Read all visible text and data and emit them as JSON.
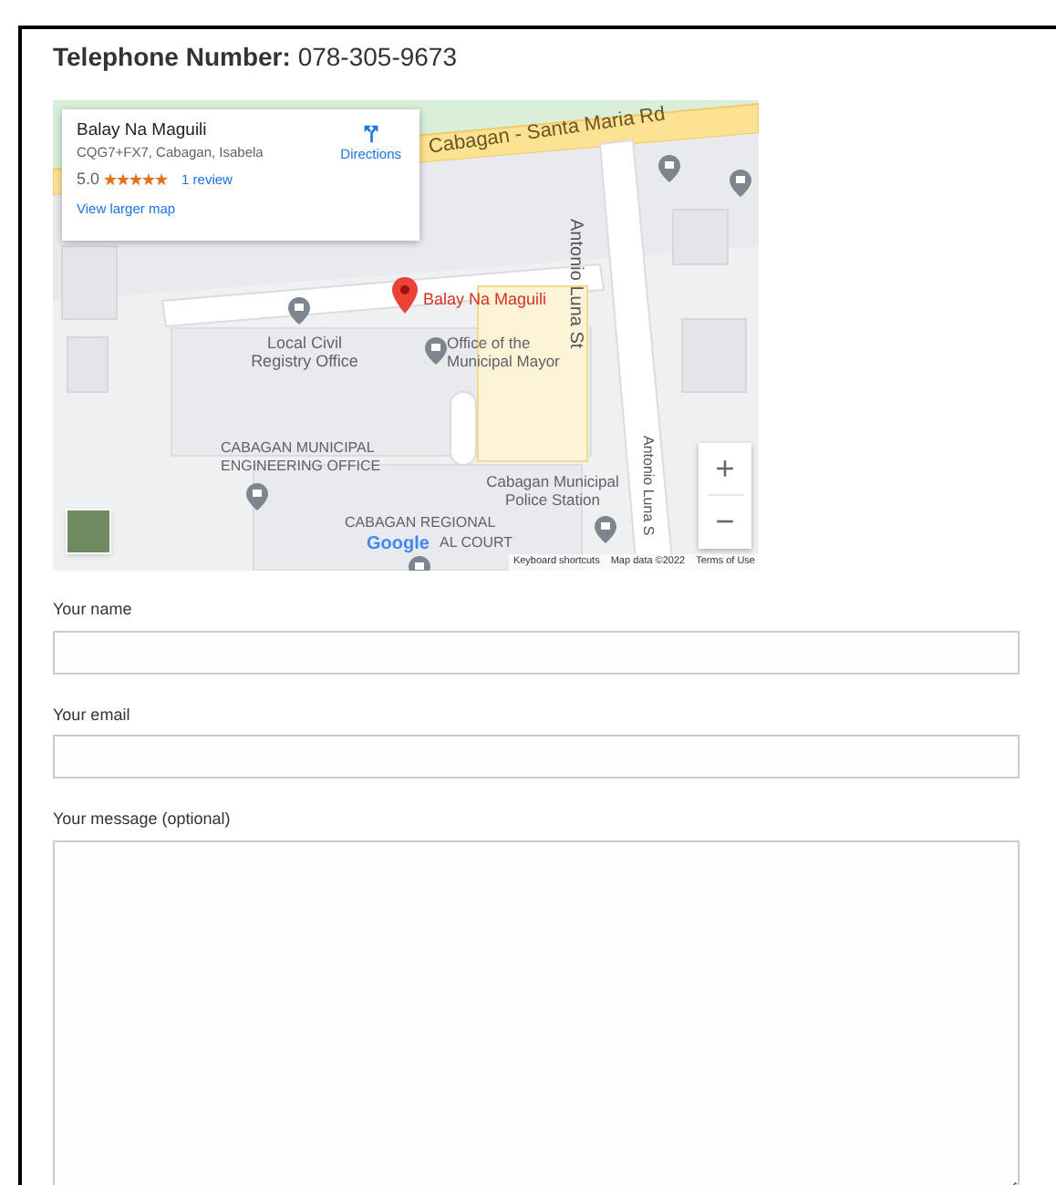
{
  "contact": {
    "label": "Telephone Number:",
    "value": "078-305-9673"
  },
  "map": {
    "info_card": {
      "title": "Balay Na Maguili",
      "address": "CQG7+FX7, Cabagan, Isabela",
      "rating": "5.0",
      "stars": 5,
      "reviews": "1 review",
      "larger_map_link": "View larger map",
      "directions": "Directions"
    },
    "labels": [
      {
        "text": "Cabagan - Santa Maria Rd",
        "kind": "road"
      },
      {
        "text": "Antonio Luna St",
        "kind": "street"
      },
      {
        "text": "Balay Na Maguili",
        "kind": "pin"
      },
      {
        "text": "Local Civil Registry Office",
        "kind": "poi"
      },
      {
        "text": "Office of the Municipal Mayor",
        "kind": "poi"
      },
      {
        "text": "CABAGAN MUNICIPAL ENGINEERING OFFICE",
        "kind": "poi"
      },
      {
        "text": "Cabagan Municipal Police Station",
        "kind": "poi"
      },
      {
        "text": "CABAGAN REGIONAL",
        "kind": "poi"
      },
      {
        "text": "AL COURT",
        "kind": "poi"
      },
      {
        "text": "Antonio Luna S",
        "kind": "street"
      }
    ],
    "zoom_in": "+",
    "zoom_out": "−",
    "logo": "Google",
    "footer": [
      "Keyboard shortcuts",
      "Map data ©2022",
      "Terms of Use"
    ]
  },
  "form": {
    "fields": [
      {
        "label": "Your name",
        "kind": "input"
      },
      {
        "label": "Your email",
        "kind": "input"
      },
      {
        "label": "Your message (optional)",
        "kind": "textarea"
      }
    ]
  }
}
